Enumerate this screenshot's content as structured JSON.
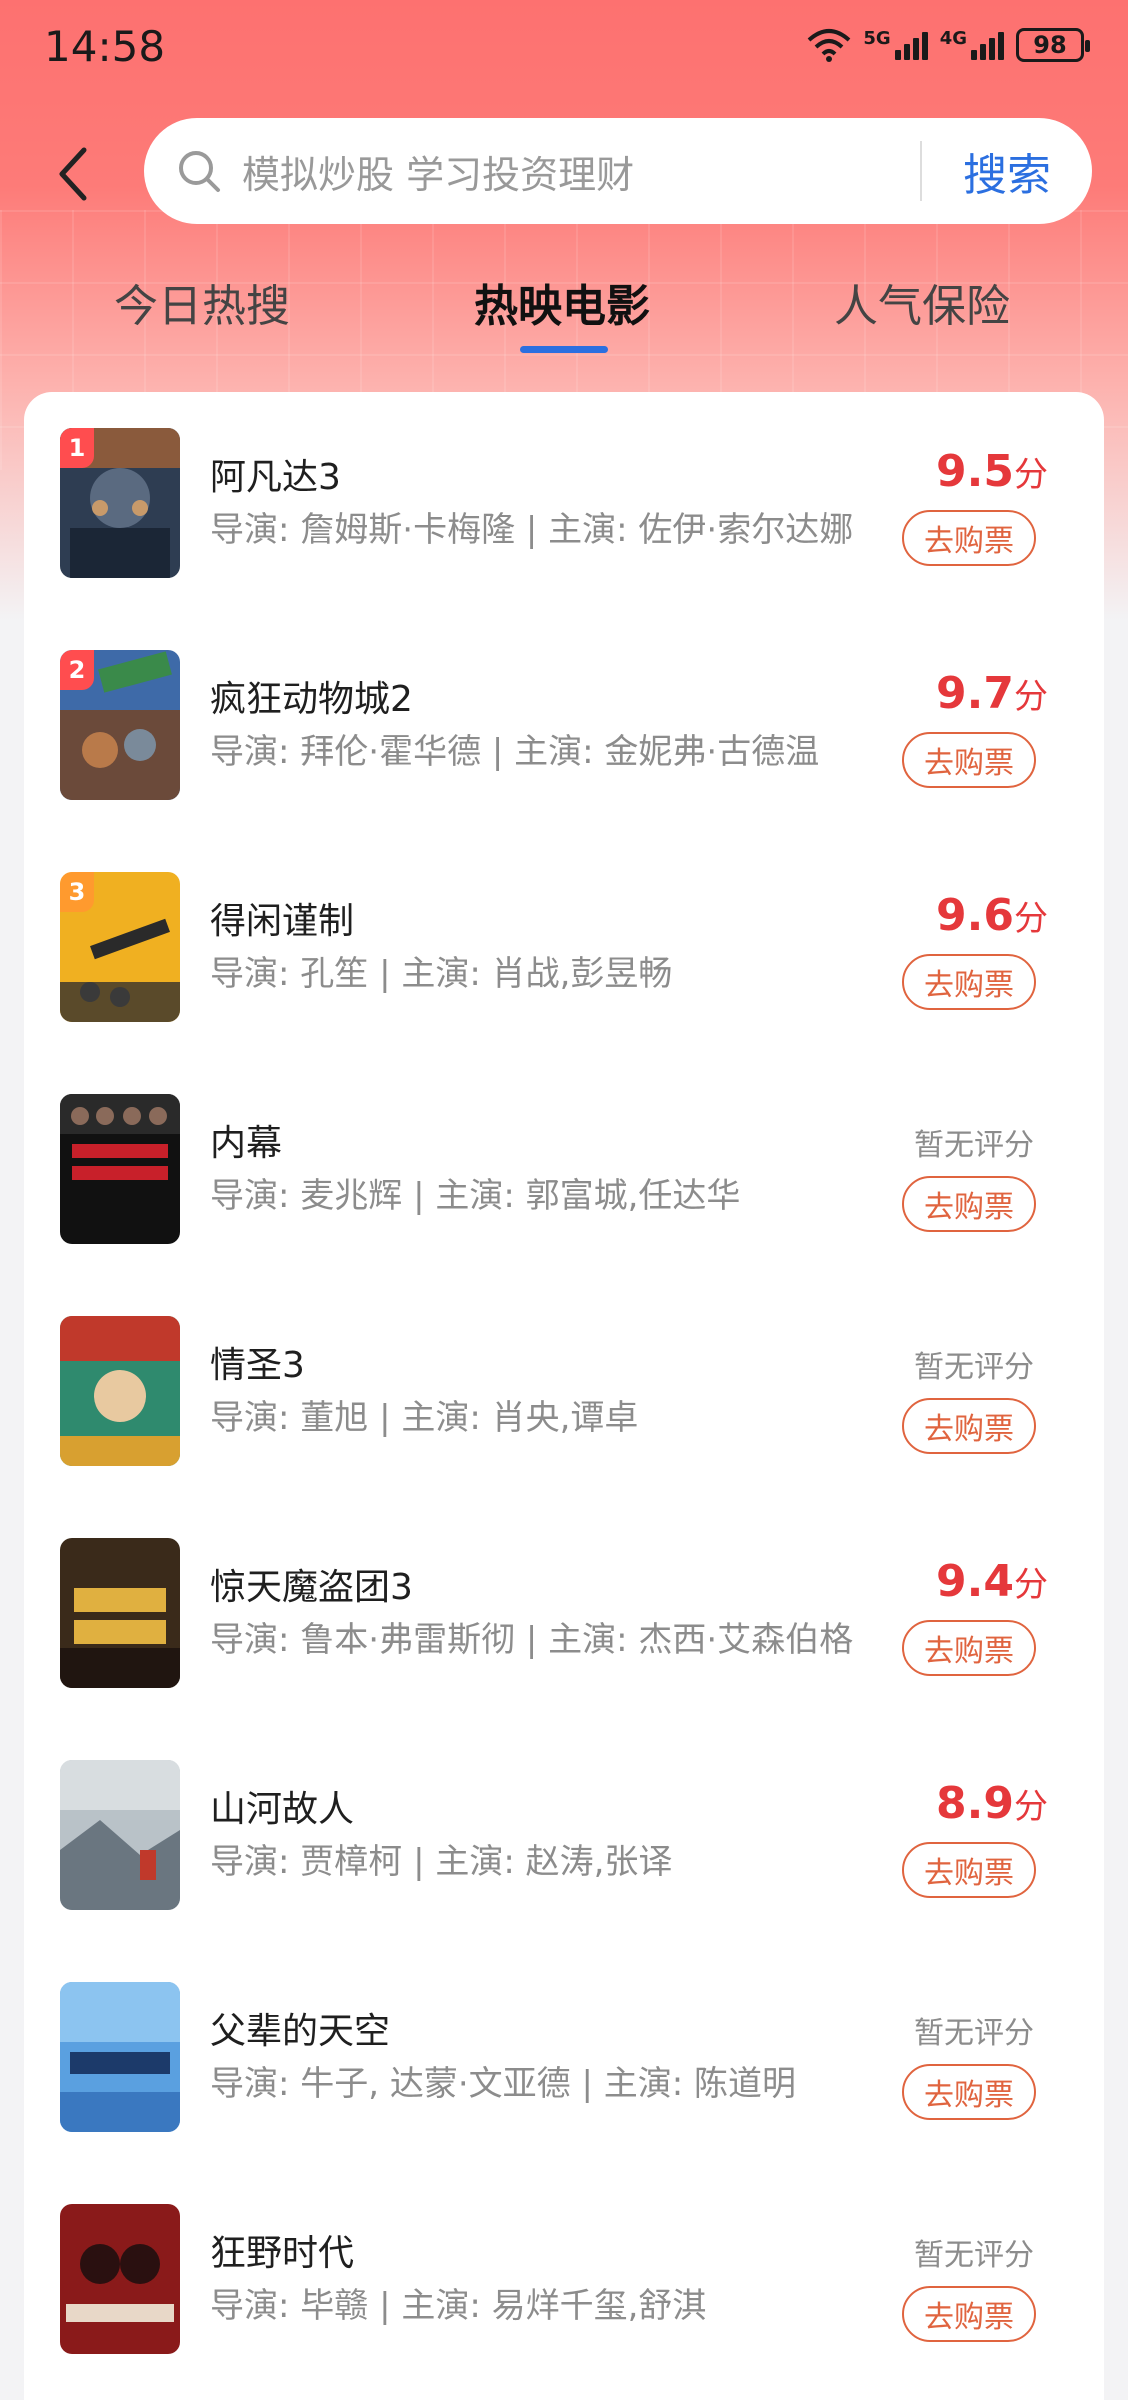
{
  "status_bar": {
    "time": "14:58",
    "net1": "5G",
    "net2": "4G",
    "battery": "98"
  },
  "search": {
    "placeholder": "模拟炒股 学习投资理财",
    "button_label": "搜索"
  },
  "tabs": [
    {
      "label": "今日热搜",
      "active": false
    },
    {
      "label": "热映电影",
      "active": true
    },
    {
      "label": "人气保险",
      "active": false
    }
  ],
  "movies": [
    {
      "rank": "1",
      "title": "阿凡达3",
      "credits": "导演: 詹姆斯·卡梅隆 | 主演: 佐伊·索尔达娜",
      "score": "9.5",
      "score_unit": "分",
      "no_score": "",
      "ticket": "去购票"
    },
    {
      "rank": "2",
      "title": "疯狂动物城2",
      "credits": "导演: 拜伦·霍华德 | 主演: 金妮弗·古德温",
      "score": "9.7",
      "score_unit": "分",
      "no_score": "",
      "ticket": "去购票"
    },
    {
      "rank": "3",
      "title": "得闲谨制",
      "credits": "导演: 孔笙 | 主演: 肖战,彭昱畅",
      "score": "9.6",
      "score_unit": "分",
      "no_score": "",
      "ticket": "去购票"
    },
    {
      "rank": "",
      "title": "内幕",
      "credits": "导演: 麦兆辉 | 主演: 郭富城,任达华",
      "score": "",
      "score_unit": "",
      "no_score": "暂无评分",
      "ticket": "去购票"
    },
    {
      "rank": "",
      "title": "情圣3",
      "credits": "导演: 董旭 | 主演: 肖央,谭卓",
      "score": "",
      "score_unit": "",
      "no_score": "暂无评分",
      "ticket": "去购票"
    },
    {
      "rank": "",
      "title": "惊天魔盗团3",
      "credits": "导演: 鲁本·弗雷斯彻 | 主演: 杰西·艾森伯格",
      "score": "9.4",
      "score_unit": "分",
      "no_score": "",
      "ticket": "去购票"
    },
    {
      "rank": "",
      "title": "山河故人",
      "credits": "导演: 贾樟柯 | 主演: 赵涛,张译",
      "score": "8.9",
      "score_unit": "分",
      "no_score": "",
      "ticket": "去购票"
    },
    {
      "rank": "",
      "title": "父辈的天空",
      "credits": "导演: 牛子, 达蒙·文亚德 | 主演: 陈道明",
      "score": "",
      "score_unit": "",
      "no_score": "暂无评分",
      "ticket": "去购票"
    },
    {
      "rank": "",
      "title": "狂野时代",
      "credits": "导演: 毕赣 | 主演: 易烊千玺,舒淇",
      "score": "",
      "score_unit": "",
      "no_score": "暂无评分",
      "ticket": "去购票"
    }
  ],
  "colors": {
    "accent_red": "#e5383b",
    "ticket_orange": "#e0643f",
    "tab_blue": "#2b6fe0",
    "header_red": "#fd7170"
  }
}
